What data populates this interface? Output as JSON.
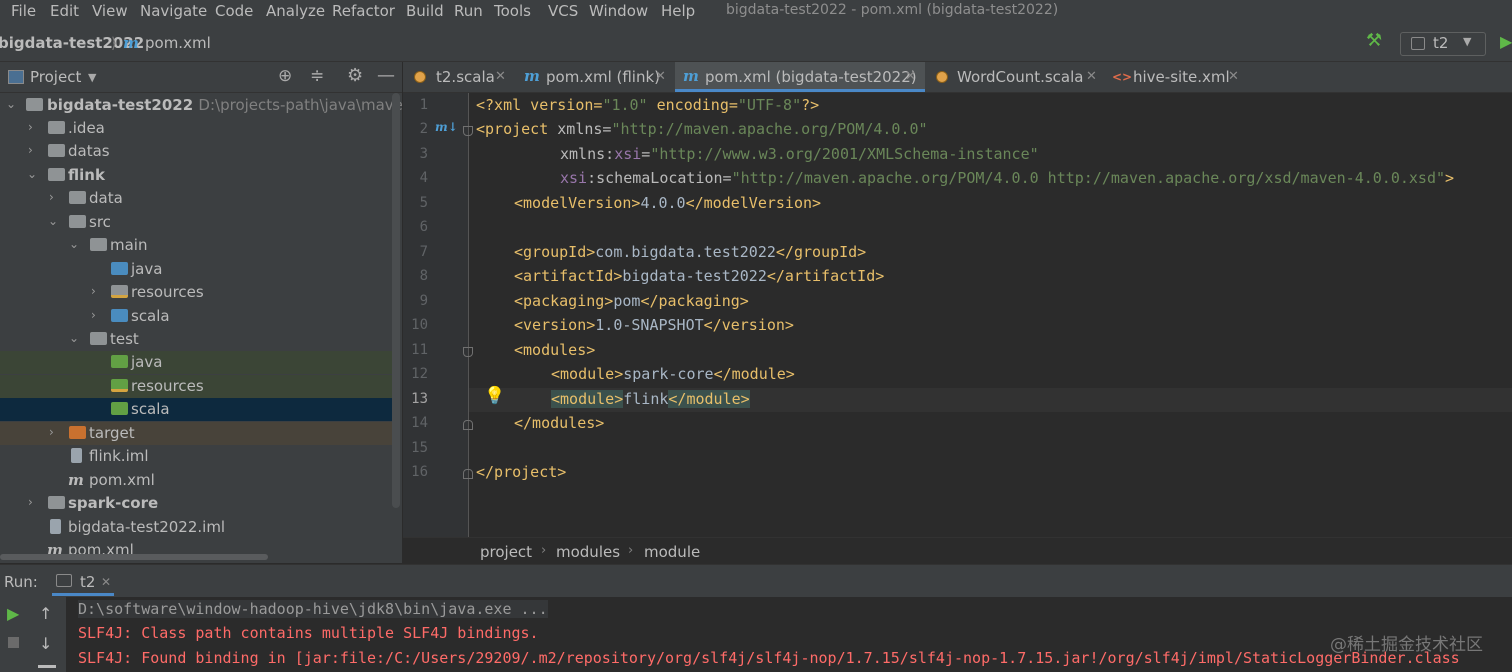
{
  "menu": {
    "items": [
      "File",
      "Edit",
      "View",
      "Navigate",
      "Code",
      "Analyze",
      "Refactor",
      "Build",
      "Run",
      "Tools",
      "VCS",
      "Window",
      "Help"
    ],
    "window_title": "bigdata-test2022 - pom.xml (bigdata-test2022)"
  },
  "navbar": {
    "project": "bigdata-test2022",
    "file": "pom.xml",
    "run_config": "t2"
  },
  "project_panel": {
    "title": "Project",
    "tree": [
      {
        "label": "bigdata-test2022",
        "path": "D:\\projects-path\\java\\maven-proj"
      },
      {
        "label": ".idea"
      },
      {
        "label": "datas"
      },
      {
        "label": "flink"
      },
      {
        "label": "data"
      },
      {
        "label": "src"
      },
      {
        "label": "main"
      },
      {
        "label": "java"
      },
      {
        "label": "resources"
      },
      {
        "label": "scala"
      },
      {
        "label": "test"
      },
      {
        "label": "java"
      },
      {
        "label": "resources"
      },
      {
        "label": "scala"
      },
      {
        "label": "target"
      },
      {
        "label": "flink.iml"
      },
      {
        "label": "pom.xml"
      },
      {
        "label": "spark-core"
      },
      {
        "label": "bigdata-test2022.iml"
      },
      {
        "label": "pom.xml"
      }
    ]
  },
  "tabs": [
    {
      "label": "t2.scala"
    },
    {
      "label": "pom.xml (flink)"
    },
    {
      "label": "pom.xml (bigdata-test2022)"
    },
    {
      "label": "WordCount.scala"
    },
    {
      "label": "hive-site.xml"
    }
  ],
  "editor": {
    "line_numbers": [
      "1",
      "2",
      "3",
      "4",
      "5",
      "6",
      "7",
      "8",
      "9",
      "10",
      "11",
      "12",
      "13",
      "14",
      "15",
      "16"
    ],
    "lines": {
      "l1_a": "<?xml version=",
      "l1_b": "\"1.0\"",
      "l1_c": " encoding=",
      "l1_d": "\"UTF-8\"",
      "l1_e": "?>",
      "l2_a": "<project ",
      "l2_b": "xmlns=",
      "l2_c": "\"http://maven.apache.org/POM/4.0.0\"",
      "l3_a": "xmlns:",
      "l3_b": "xsi",
      "l3_c": "=",
      "l3_d": "\"http://www.w3.org/2001/XMLSchema-instance\"",
      "l4_a": "xsi",
      "l4_b": ":schemaLocation=",
      "l4_c": "\"http://maven.apache.org/POM/4.0.0 http://maven.apache.org/xsd/maven-4.0.0.xsd\"",
      "l4_d": ">",
      "l5_a": "<modelVersion>",
      "l5_b": "4.0.0",
      "l5_c": "</modelVersion>",
      "l7_a": "<groupId>",
      "l7_b": "com.bigdata.test2022",
      "l7_c": "</groupId>",
      "l8_a": "<artifactId>",
      "l8_b": "bigdata-test2022",
      "l8_c": "</artifactId>",
      "l9_a": "<packaging>",
      "l9_b": "pom",
      "l9_c": "</packaging>",
      "l10_a": "<version>",
      "l10_b": "1.0-SNAPSHOT",
      "l10_c": "</version>",
      "l11_a": "<modules>",
      "l12_a": "<module>",
      "l12_b": "spark-core",
      "l12_c": "</module>",
      "l13_a": "<module>",
      "l13_b": "flink",
      "l13_c": "</module>",
      "l14_a": "</modules>",
      "l16_a": "</project>"
    }
  },
  "breadcrumbs": [
    "project",
    "modules",
    "module"
  ],
  "run_panel": {
    "label": "Run:",
    "tab": "t2",
    "console": [
      {
        "text": "D:\\software\\window-hadoop-hive\\jdk8\\bin\\java.exe ...",
        "color": "#9a9a9a"
      },
      {
        "text": "SLF4J: Class path contains multiple SLF4J bindings.",
        "color": "#ff6b68"
      },
      {
        "text": "SLF4J: Found binding in [jar:file:/C:/Users/29209/.m2/repository/org/slf4j/slf4j-nop/1.7.15/slf4j-nop-1.7.15.jar!/org/slf4j/impl/StaticLoggerBinder.class",
        "color": "#ff6b68"
      }
    ]
  },
  "watermark": "@稀土掘金技术社区",
  "colors": {
    "accent": "#4a88c7",
    "tag": "#e8bf6a",
    "string": "#6a8759",
    "error": "#ff6b68"
  }
}
